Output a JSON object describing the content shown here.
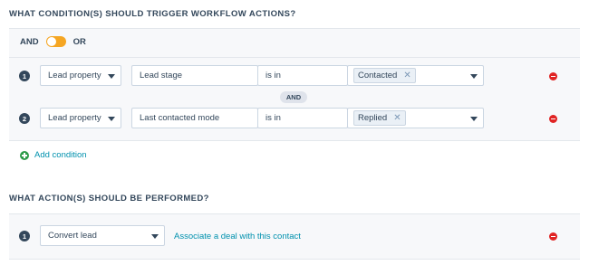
{
  "conditions_heading": "WHAT CONDITION(S) SHOULD TRIGGER WORKFLOW ACTIONS?",
  "logic_toggle": {
    "left_label": "AND",
    "right_label": "OR"
  },
  "conditions": [
    {
      "number": "1",
      "property_type": "Lead property",
      "property": "Lead stage",
      "operator": "is in",
      "values": [
        "Contacted"
      ]
    },
    {
      "number": "2",
      "property_type": "Lead property",
      "property": "Last contacted mode",
      "operator": "is in",
      "values": [
        "Replied"
      ]
    }
  ],
  "joiner_label": "AND",
  "add_condition_label": "Add condition",
  "actions_heading": "WHAT ACTION(S) SHOULD BE PERFORMED?",
  "actions": [
    {
      "number": "1",
      "action": "Convert lead",
      "link_text": "Associate a deal with this contact"
    }
  ],
  "colors": {
    "toggle": "#f5a623",
    "remove": "#e02424",
    "link": "#0091ae",
    "add": "#2e9b4a"
  },
  "icons": {
    "remove": "remove-circle-icon",
    "add": "plus-circle-icon",
    "tag_remove": "close-icon",
    "dropdown": "caret-down-icon"
  }
}
